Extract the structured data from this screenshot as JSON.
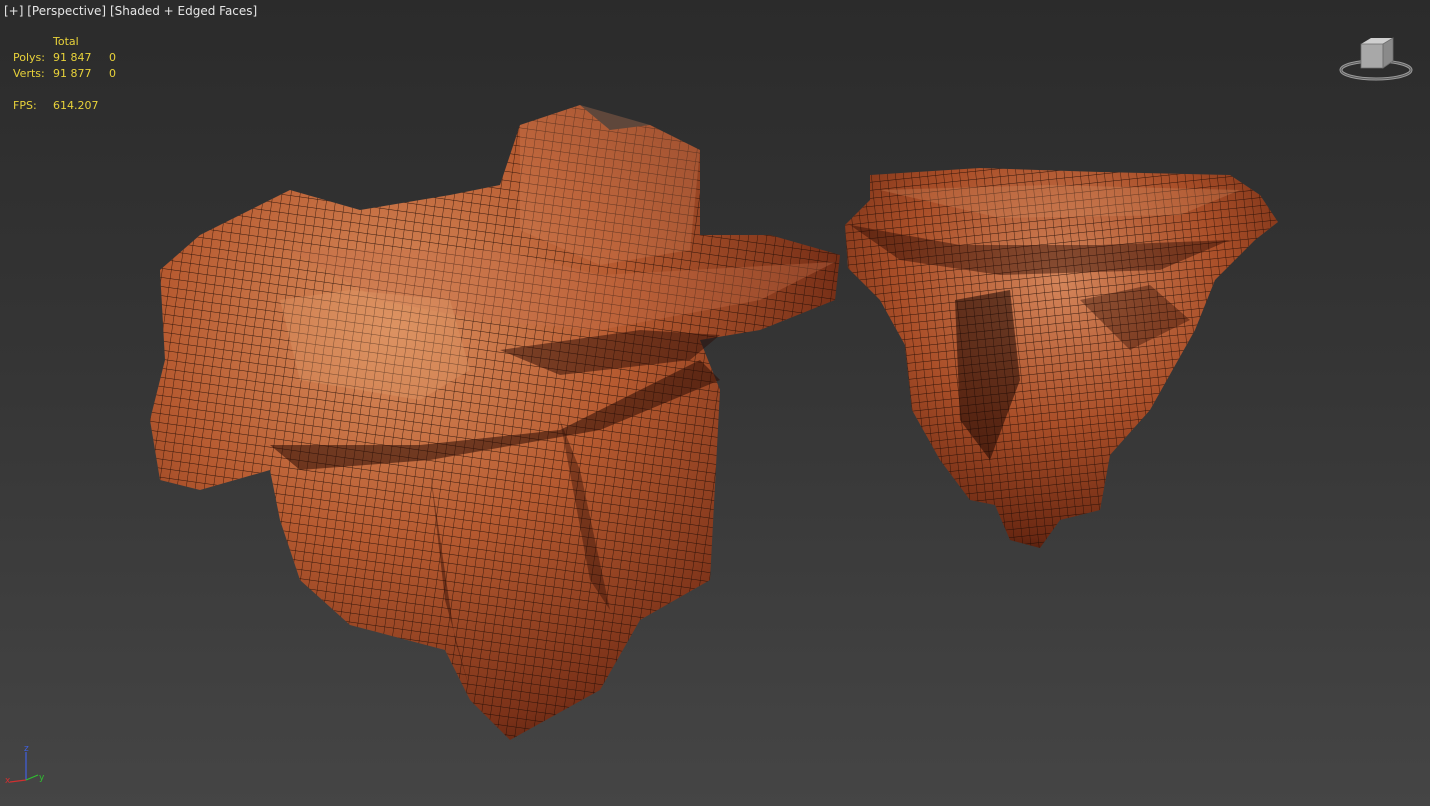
{
  "viewport": {
    "label": {
      "menu": "[+]",
      "view": "[Perspective]",
      "shading": "[Shaded + Edged Faces]"
    },
    "stats": {
      "header": "Total",
      "polys_label": "Polys:",
      "polys_total": "91 847",
      "polys_selected": "0",
      "verts_label": "Verts:",
      "verts_total": "91 877",
      "verts_selected": "0",
      "fps_label": "FPS:",
      "fps_value": "614.207"
    },
    "axis_tripod": {
      "z": "z",
      "x": "x",
      "y": "y"
    },
    "colors": {
      "stats_text": "#e8d23a",
      "label_text": "#e6e6e6",
      "rock_base": "#b0542c",
      "rock_highlight": "#d98a5a",
      "rock_shadow": "#4a1a0c",
      "axis_x": "#d03030",
      "axis_y": "#30c030",
      "axis_z": "#4060e0"
    },
    "icons": [
      "viewcube-icon",
      "axis-tripod-icon"
    ],
    "objects": [
      "large-rock-mesh",
      "small-rock-mesh"
    ]
  }
}
